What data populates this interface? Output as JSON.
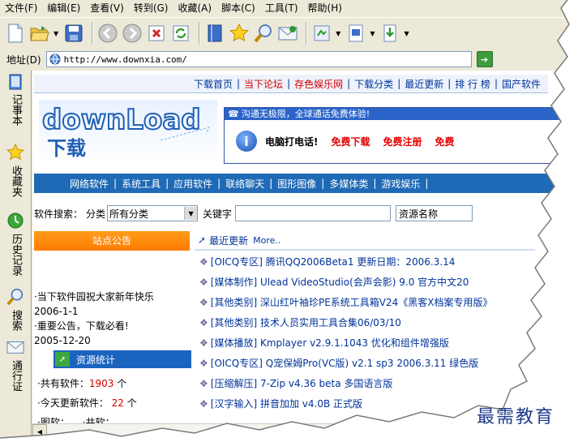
{
  "menu": [
    "文件(F)",
    "编辑(E)",
    "查看(V)",
    "转到(G)",
    "收藏(A)",
    "脚本(C)",
    "工具(T)",
    "帮助(H)"
  ],
  "toolbar": {
    "icons": [
      "new-page-icon",
      "open-folder-icon",
      "save-icon",
      "back-icon",
      "forward-icon",
      "stop-icon",
      "refresh-icon",
      "book-icon",
      "favorites-star-icon",
      "search-magnifier-icon",
      "mail-icon",
      "settings-icon",
      "page-icon",
      "download-icon"
    ]
  },
  "address": {
    "label": "地址(D)",
    "url": "http://www.downxia.com/"
  },
  "leftbar": [
    {
      "icon": "notepad-icon",
      "label": "记事本"
    },
    {
      "icon": "favorites-star-icon",
      "label": "收藏夹"
    },
    {
      "icon": "history-icon",
      "label": "历史记录"
    },
    {
      "icon": "search-magnifier-icon",
      "label": "搜索"
    },
    {
      "icon": "communication-icon",
      "label": "通行证"
    }
  ],
  "topnav": [
    {
      "label": "下载首页",
      "color": "#00339a"
    },
    {
      "label": "当下论坛",
      "color": "#d40000"
    },
    {
      "label": "存色娱乐网",
      "color": "#d40000"
    },
    {
      "label": "下载分类",
      "color": "#00339a"
    },
    {
      "label": "最近更新",
      "color": "#00339a"
    },
    {
      "label": "排 行 榜",
      "color": "#00339a"
    },
    {
      "label": "国产软件",
      "color": "#00339a"
    }
  ],
  "logo": {
    "text": "downLoad",
    "sub": "下载"
  },
  "ad": {
    "title": "沟通无极限，全球通话免费体验!",
    "lead": "电脑打电话!",
    "links": [
      "免费下载",
      "免费注册",
      "免费"
    ]
  },
  "catnav": [
    "网络软件",
    "系统工具",
    "应用软件",
    "联络聊天",
    "图形图像",
    "多媒体类",
    "游戏娱乐"
  ],
  "search": {
    "label": "软件搜索：",
    "cat_label": "分类",
    "cat_value": "所有分类",
    "kw_label": "关键字",
    "res_label": "资源名称"
  },
  "notice": {
    "head": "站点公告",
    "items": [
      {
        "text": "·当下软件园祝大家新年快乐",
        "date": "2006-1-1"
      },
      {
        "text": "·重要公告，下载必看!",
        "date": "2005-12-20"
      }
    ]
  },
  "stats": {
    "head": "资源统计",
    "total_label": "·共有软件：",
    "total": "1903",
    "unit": "个",
    "today_label": "·今天更新软件：",
    "today": "22",
    "extra": "·图软：…  ·共软：…"
  },
  "latest": {
    "head": "最近更新",
    "more": "More..",
    "items": [
      {
        "cat": "[OICQ专区]",
        "title": "腾讯QQ2006Beta1 更新日期：2006.3.14"
      },
      {
        "cat": "[媒体制作]",
        "title": "Ulead VideoStudio(会声会影) 9.0 官方中文20"
      },
      {
        "cat": "[其他类别]",
        "title": "深山红叶袖珍PE系统工具箱V24《黑客X档案专用版》"
      },
      {
        "cat": "[其他类别]",
        "title": "技术人员实用工具合集06/03/10"
      },
      {
        "cat": "[媒体播放]",
        "title": "Kmplayer v2.9.1.1043 优化和组件增强版"
      },
      {
        "cat": "[OICQ专区]",
        "title": "Q宠保姆Pro(VC版) v2.1 sp3 2006.3.11 绿色版"
      },
      {
        "cat": "[压缩解压]",
        "title": "7-Zip v4.36 beta 多国语言版"
      },
      {
        "cat": "[汉字输入]",
        "title": "拼音加加 v4.0B 正式版"
      }
    ]
  },
  "watermark": "最需教育",
  "colors": {
    "nav_blue": "#1f6ab6",
    "link_blue": "#00339a",
    "link_red": "#d40000",
    "notice_orange": "#ff8a00"
  }
}
